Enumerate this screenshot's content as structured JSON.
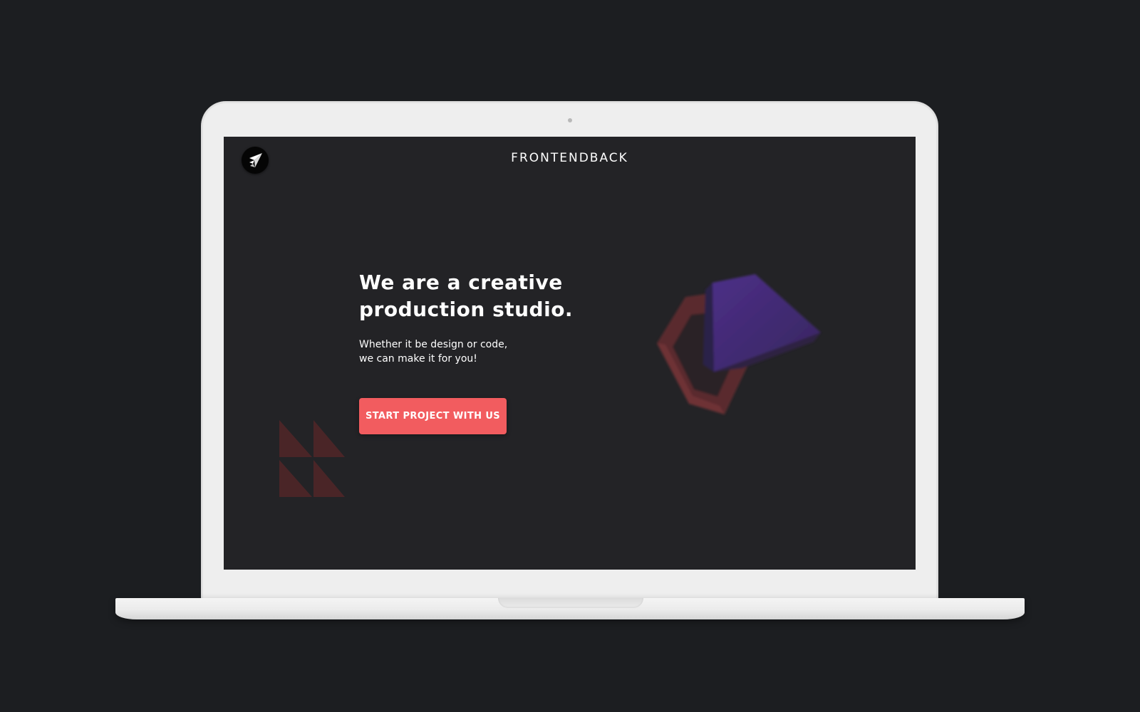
{
  "device": "laptop",
  "site": {
    "brand": "FRONTENDBACK",
    "logo_icon": "paper-plane-icon",
    "hero": {
      "headline_line1": "We are a creative",
      "headline_line2": "production studio.",
      "subline_line1": "Whether it be design or code,",
      "subline_line2": "we can make it for you!",
      "cta_label": "START PROJECT WITH US"
    },
    "decorations": [
      "triangles-grid",
      "red-hexagon-ring",
      "purple-pyramid"
    ]
  },
  "colors": {
    "page_background": "#1c1e21",
    "screen_background": "#232326",
    "accent": "#f25c5f",
    "text": "#ffffff",
    "laptop_body": "#eeeeee"
  }
}
